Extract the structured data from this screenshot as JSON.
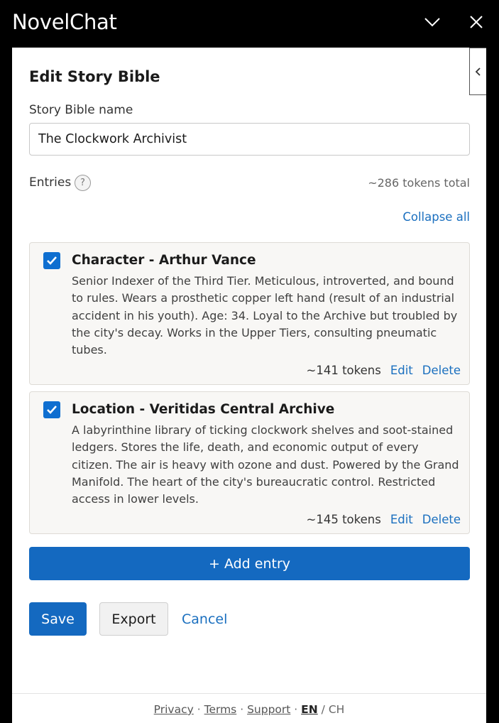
{
  "window": {
    "title": "NovelChat"
  },
  "form": {
    "page_title": "Edit Story Bible",
    "name_label": "Story Bible name",
    "name_value": "The Clockwork Archivist",
    "entries_label": "Entries",
    "help_glyph": "?",
    "tokens_total": "~286 tokens total",
    "collapse_all": "Collapse all"
  },
  "entries": [
    {
      "checked": true,
      "title": "Character - Arthur Vance",
      "description": "Senior Indexer of the Third Tier. Meticulous, introverted, and bound to rules. Wears a prosthetic copper left hand (result of an industrial accident in his youth). Age: 34. Loyal to the Archive but troubled by the city's decay. Works in the Upper Tiers, consulting pneumatic tubes.",
      "tokens": "~141 tokens",
      "edit_label": "Edit",
      "delete_label": "Delete"
    },
    {
      "checked": true,
      "title": "Location - Veritidas Central Archive",
      "description": "A labyrinthine library of ticking clockwork shelves and soot-stained ledgers. Stores the life, death, and economic output of every citizen. The air is heavy with ozone and dust. Powered by the Grand Manifold. The heart of the city's bureaucratic control. Restricted access in lower levels.",
      "tokens": "~145 tokens",
      "edit_label": "Edit",
      "delete_label": "Delete"
    }
  ],
  "actions": {
    "add_entry": "+ Add entry",
    "save": "Save",
    "export": "Export",
    "cancel": "Cancel"
  },
  "footer": {
    "privacy": "Privacy",
    "terms": "Terms",
    "support": "Support",
    "separator": "·",
    "lang_en": "EN",
    "lang_sep": "/",
    "lang_ch": "CH"
  },
  "colors": {
    "accent": "#1469c0",
    "link": "#1a6fbf",
    "card_bg": "#f8f7f5"
  },
  "icons": {
    "minimize": "chevron-down-icon",
    "close": "close-icon",
    "collapse_panel": "chevron-left-icon",
    "help": "help-icon",
    "checkbox": "checkmark-icon"
  }
}
